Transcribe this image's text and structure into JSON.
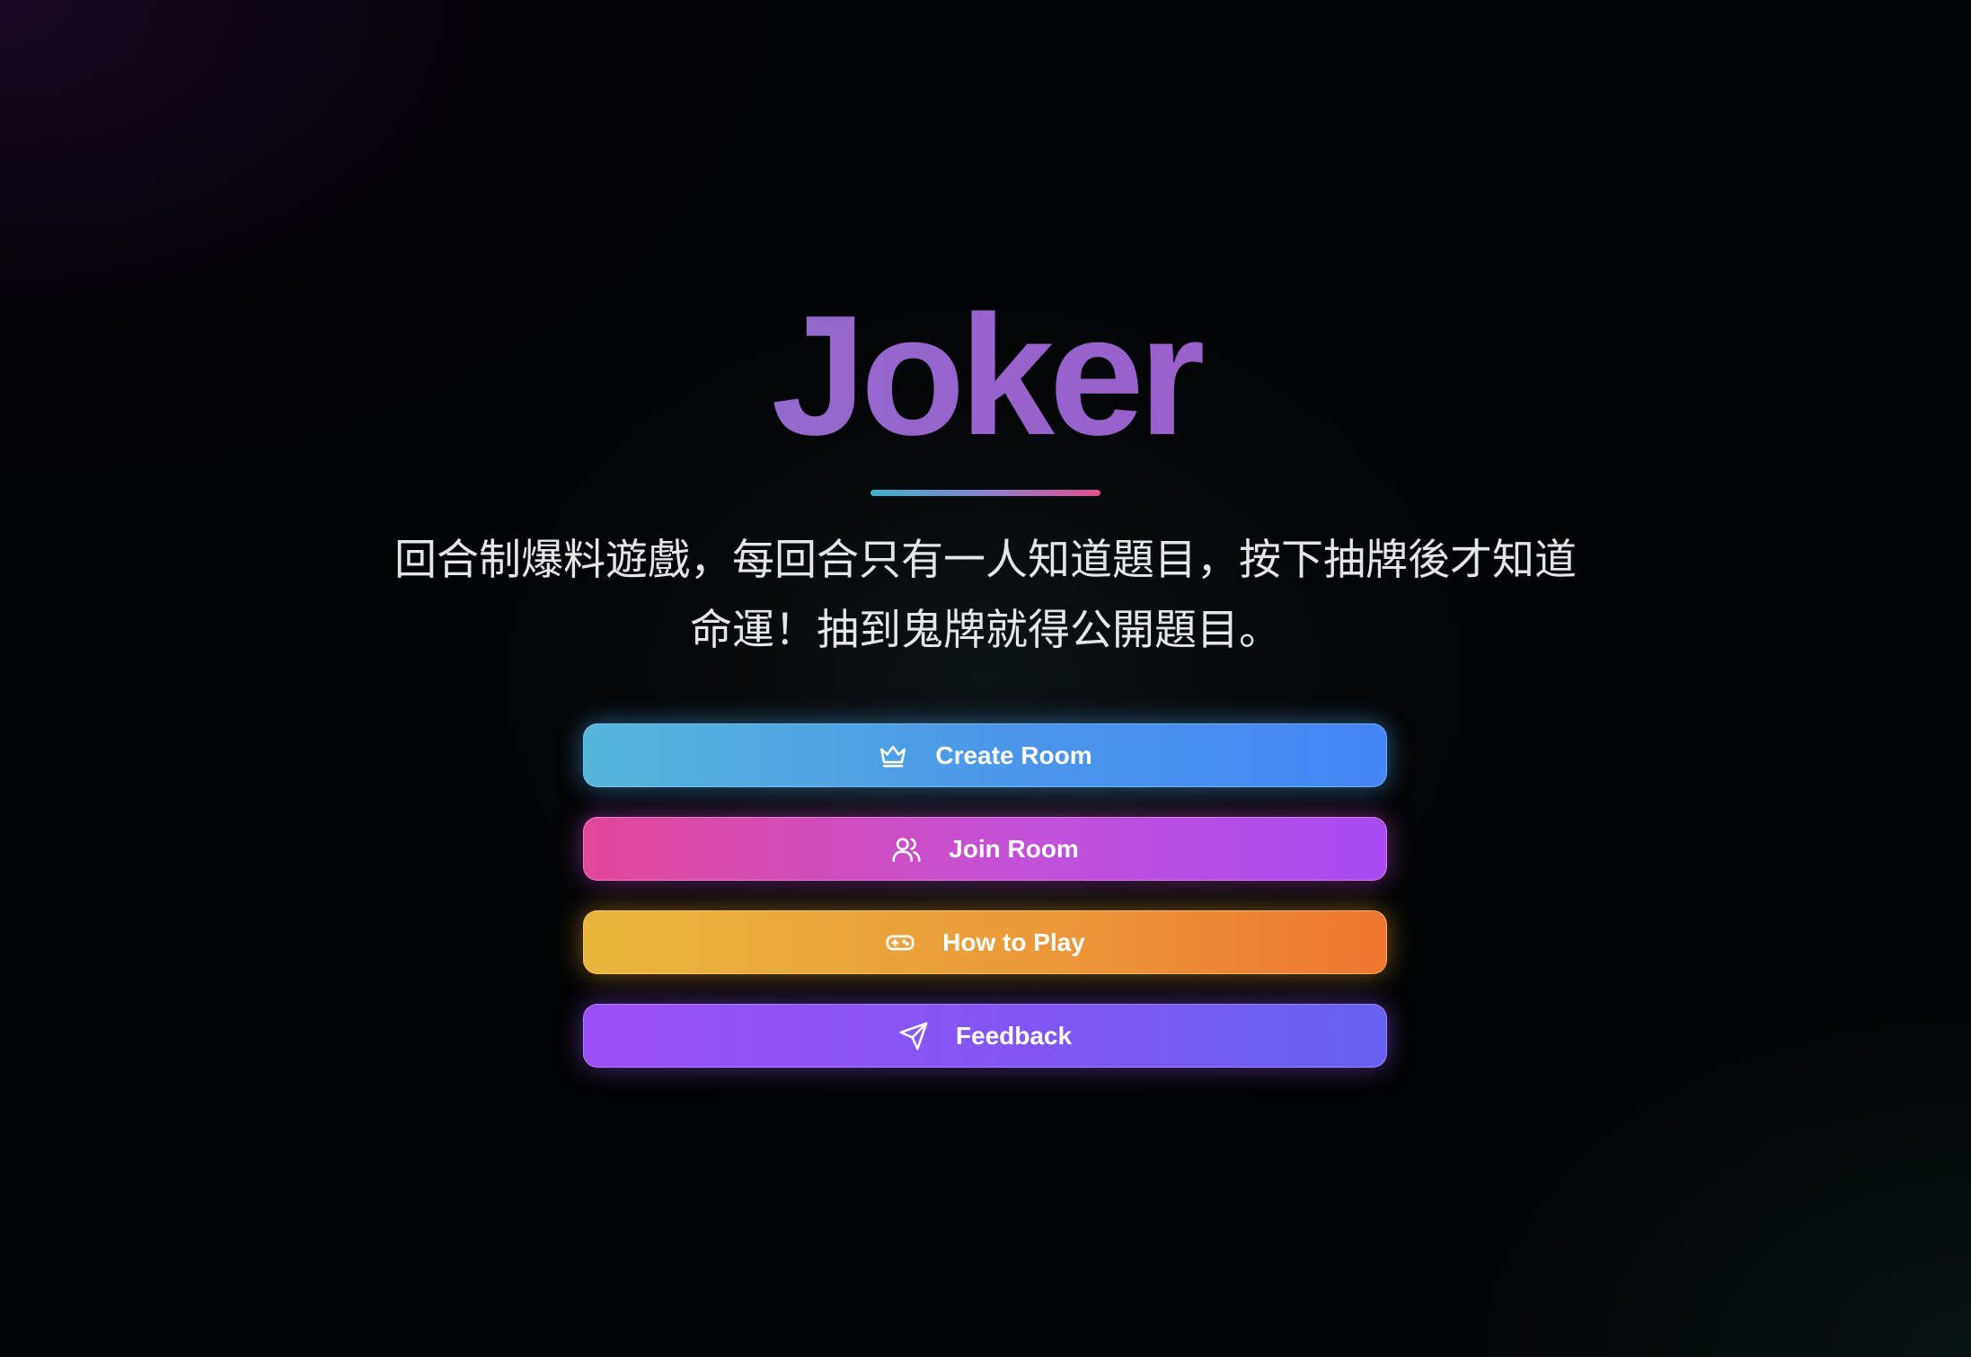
{
  "app": {
    "title": "Joker",
    "description_line1": "回合制爆料遊戲，每回合只有一人知道題目，按下抽牌後才知道",
    "description_line2": "命運！抽到鬼牌就得公開題目。"
  },
  "actions": {
    "create_room": {
      "label": "Create Room",
      "icon": "crown-icon"
    },
    "join_room": {
      "label": "Join Room",
      "icon": "users-icon"
    },
    "how_to_play": {
      "label": "How to Play",
      "icon": "gamepad-icon"
    },
    "feedback": {
      "label": "Feedback",
      "icon": "send-icon"
    }
  },
  "colors": {
    "background": "#030405",
    "title_gradient": [
      "#8a7bd0",
      "#a060c4"
    ],
    "create_room": [
      "#55b6da",
      "#4585f6"
    ],
    "join_room": [
      "#e2489a",
      "#a84cf2"
    ],
    "how_to_play": [
      "#e9b63c",
      "#ee7631"
    ],
    "feedback": [
      "#9b4ff6",
      "#6661f1"
    ]
  }
}
